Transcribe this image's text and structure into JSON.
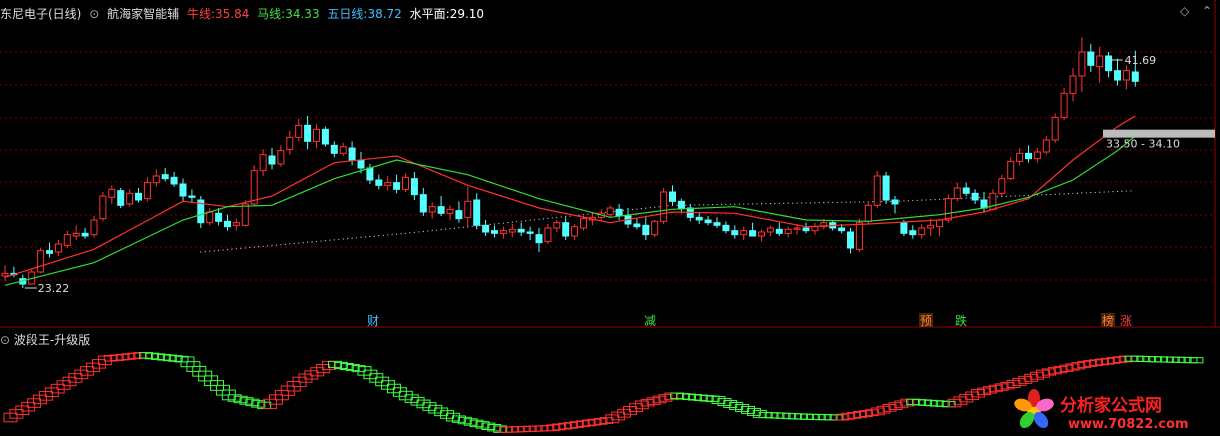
{
  "header": {
    "stock_title": "东尼电子(日线)",
    "indicator_name": "航海家智能辅",
    "ma_labels": [
      {
        "name": "牛线:",
        "value": "35.84",
        "color": "#ff4040"
      },
      {
        "name": "马线:",
        "value": "34.33",
        "color": "#40e040"
      },
      {
        "name": "五日线:",
        "value": "38.72",
        "color": "#40c0ff"
      },
      {
        "name": "水平面:",
        "value": "29.10",
        "color": "#ffffff"
      }
    ]
  },
  "sub_header": {
    "indicator_name": "波段王-升级版"
  },
  "signals": [
    {
      "text": "财",
      "color": "#40c0ff"
    },
    {
      "text": "减",
      "color": "#40e040"
    },
    {
      "text": "预",
      "color": "#ff8040"
    },
    {
      "text": "跌",
      "color": "#40e040"
    },
    {
      "text": "榜",
      "color": "#ff8040"
    },
    {
      "text": "涨",
      "color": "#ff4040"
    }
  ],
  "annotations": {
    "low_label": "23.22",
    "high_label": "41.69",
    "range_label": "33.50 - 34.10"
  },
  "watermark": {
    "name": "分析家公式网",
    "url": "www.70822.com"
  },
  "colors": {
    "up": "#ff3232",
    "down": "#54ffff",
    "ma_bull": "#ff3030",
    "ma_horse": "#30e030",
    "level_dots": "#cccccc",
    "grid": "#800000",
    "wave_up": "#ff3030",
    "wave_down": "#40ff40"
  },
  "chart_data": [
    {
      "type": "candlestick",
      "title": "东尼电子(日线)",
      "ylim": [
        22,
        43
      ],
      "candles": [
        [
          23.8,
          24.6,
          23.4,
          24.0
        ],
        [
          24.0,
          24.5,
          23.7,
          23.9
        ],
        [
          23.6,
          23.9,
          22.9,
          23.2
        ],
        [
          23.2,
          24.3,
          23.2,
          24.1
        ],
        [
          24.1,
          25.9,
          24.0,
          25.7
        ],
        [
          25.7,
          26.3,
          25.2,
          25.5
        ],
        [
          25.6,
          26.5,
          25.3,
          26.2
        ],
        [
          26.1,
          27.2,
          25.9,
          26.9
        ],
        [
          26.8,
          27.6,
          26.5,
          27.0
        ],
        [
          27.0,
          27.4,
          26.6,
          26.8
        ],
        [
          26.9,
          28.3,
          26.7,
          28.0
        ],
        [
          28.1,
          30.1,
          27.9,
          29.8
        ],
        [
          29.7,
          30.6,
          29.2,
          30.3
        ],
        [
          30.2,
          30.4,
          28.9,
          29.1
        ],
        [
          29.2,
          30.3,
          29.0,
          30.0
        ],
        [
          30.0,
          30.4,
          29.3,
          29.5
        ],
        [
          29.6,
          31.2,
          29.4,
          30.8
        ],
        [
          30.8,
          31.8,
          30.5,
          31.3
        ],
        [
          31.4,
          31.9,
          30.9,
          31.1
        ],
        [
          31.2,
          31.6,
          30.5,
          30.7
        ],
        [
          30.7,
          31.1,
          29.4,
          29.8
        ],
        [
          29.8,
          30.3,
          29.3,
          29.7
        ],
        [
          29.5,
          29.8,
          27.4,
          27.8
        ],
        [
          27.8,
          28.9,
          27.6,
          28.6
        ],
        [
          28.5,
          28.9,
          27.6,
          27.9
        ],
        [
          27.9,
          28.4,
          27.2,
          27.5
        ],
        [
          27.6,
          28.1,
          27.2,
          27.8
        ],
        [
          27.6,
          29.5,
          27.5,
          29.2
        ],
        [
          29.2,
          32.1,
          29.1,
          31.7
        ],
        [
          31.7,
          33.3,
          31.3,
          32.9
        ],
        [
          32.8,
          33.4,
          31.8,
          32.2
        ],
        [
          32.2,
          33.6,
          32.0,
          33.2
        ],
        [
          33.3,
          34.7,
          32.9,
          34.2
        ],
        [
          34.2,
          35.6,
          33.9,
          35.1
        ],
        [
          35.1,
          35.8,
          33.3,
          33.9
        ],
        [
          33.9,
          35.2,
          33.4,
          34.8
        ],
        [
          34.8,
          35.0,
          33.5,
          33.7
        ],
        [
          33.6,
          33.9,
          32.7,
          33.0
        ],
        [
          33.0,
          33.8,
          32.8,
          33.5
        ],
        [
          33.4,
          33.9,
          32.1,
          32.5
        ],
        [
          32.5,
          33.1,
          31.5,
          31.9
        ],
        [
          31.9,
          32.2,
          30.7,
          31.0
        ],
        [
          31.0,
          31.4,
          30.3,
          30.6
        ],
        [
          30.6,
          31.3,
          30.2,
          30.8
        ],
        [
          30.8,
          31.4,
          30.0,
          30.3
        ],
        [
          30.3,
          31.5,
          30.1,
          31.2
        ],
        [
          31.1,
          31.6,
          29.5,
          29.9
        ],
        [
          29.9,
          30.4,
          28.3,
          28.6
        ],
        [
          28.6,
          29.3,
          28.1,
          29.0
        ],
        [
          29.0,
          29.8,
          28.3,
          28.5
        ],
        [
          28.5,
          29.1,
          28.0,
          28.8
        ],
        [
          28.7,
          29.4,
          27.8,
          28.1
        ],
        [
          28.2,
          30.5,
          27.4,
          29.4
        ],
        [
          29.5,
          30.0,
          27.3,
          27.6
        ],
        [
          27.6,
          28.0,
          26.8,
          27.1
        ],
        [
          27.2,
          27.6,
          26.7,
          27.0
        ],
        [
          27.0,
          27.5,
          26.6,
          27.2
        ],
        [
          27.1,
          27.7,
          26.7,
          27.3
        ],
        [
          27.3,
          27.8,
          26.8,
          27.1
        ],
        [
          27.1,
          27.5,
          26.5,
          27.0
        ],
        [
          26.9,
          27.4,
          25.6,
          26.3
        ],
        [
          26.4,
          27.7,
          26.2,
          27.4
        ],
        [
          27.4,
          28.0,
          27.1,
          27.8
        ],
        [
          27.8,
          28.2,
          26.5,
          26.8
        ],
        [
          26.8,
          27.7,
          26.5,
          27.5
        ],
        [
          27.4,
          28.3,
          27.2,
          28.1
        ],
        [
          28.0,
          28.4,
          27.6,
          28.2
        ],
        [
          28.2,
          28.8,
          27.9,
          28.5
        ],
        [
          28.4,
          29.1,
          28.2,
          28.9
        ],
        [
          28.8,
          29.2,
          28.0,
          28.3
        ],
        [
          28.3,
          28.9,
          27.4,
          27.7
        ],
        [
          27.7,
          28.1,
          27.3,
          27.5
        ],
        [
          27.6,
          28.2,
          26.5,
          26.9
        ],
        [
          26.9,
          28.0,
          26.7,
          27.9
        ],
        [
          27.9,
          30.4,
          27.7,
          30.1
        ],
        [
          30.1,
          30.6,
          29.1,
          29.4
        ],
        [
          29.4,
          29.6,
          28.5,
          28.9
        ],
        [
          28.9,
          29.2,
          27.9,
          28.2
        ],
        [
          28.2,
          28.6,
          27.7,
          28.0
        ],
        [
          28.0,
          28.3,
          27.6,
          27.8
        ],
        [
          27.8,
          28.2,
          27.4,
          27.6
        ],
        [
          27.6,
          27.9,
          27.0,
          27.2
        ],
        [
          27.2,
          27.6,
          26.6,
          26.9
        ],
        [
          26.9,
          27.5,
          26.5,
          27.2
        ],
        [
          27.2,
          27.8,
          26.8,
          26.8
        ],
        [
          26.8,
          27.3,
          26.4,
          27.1
        ],
        [
          27.1,
          27.6,
          26.8,
          27.4
        ],
        [
          27.3,
          27.8,
          26.8,
          27.0
        ],
        [
          27.0,
          27.5,
          26.7,
          27.3
        ],
        [
          27.3,
          27.7,
          26.9,
          27.4
        ],
        [
          27.4,
          27.8,
          27.0,
          27.2
        ],
        [
          27.2,
          27.8,
          26.9,
          27.5
        ],
        [
          27.5,
          28.1,
          27.3,
          27.8
        ],
        [
          27.8,
          28.0,
          27.2,
          27.4
        ],
        [
          27.4,
          27.7,
          27.0,
          27.2
        ],
        [
          27.1,
          27.4,
          25.5,
          25.9
        ],
        [
          25.8,
          28.1,
          25.6,
          27.8
        ],
        [
          27.9,
          29.4,
          27.7,
          29.1
        ],
        [
          29.1,
          31.7,
          28.9,
          31.3
        ],
        [
          31.3,
          31.6,
          29.2,
          29.5
        ],
        [
          29.5,
          29.8,
          28.5,
          29.2
        ],
        [
          27.8,
          28.0,
          26.8,
          27.0
        ],
        [
          27.2,
          27.6,
          26.6,
          26.9
        ],
        [
          26.9,
          27.7,
          26.6,
          27.4
        ],
        [
          27.4,
          28.1,
          26.8,
          27.6
        ],
        [
          27.5,
          28.1,
          26.8,
          28.0
        ],
        [
          28.0,
          29.9,
          27.8,
          29.6
        ],
        [
          29.6,
          30.8,
          29.4,
          30.4
        ],
        [
          30.4,
          30.8,
          29.8,
          30.0
        ],
        [
          30.0,
          30.3,
          29.2,
          29.5
        ],
        [
          29.5,
          30.1,
          28.6,
          28.9
        ],
        [
          28.8,
          30.3,
          28.7,
          30.0
        ],
        [
          30.0,
          31.4,
          29.8,
          31.1
        ],
        [
          31.1,
          32.7,
          31.0,
          32.4
        ],
        [
          32.4,
          33.4,
          32.1,
          33.0
        ],
        [
          33.0,
          33.6,
          32.3,
          32.6
        ],
        [
          32.6,
          33.4,
          32.3,
          33.1
        ],
        [
          33.1,
          34.3,
          32.9,
          34.0
        ],
        [
          34.0,
          36.0,
          33.8,
          35.7
        ],
        [
          35.7,
          37.9,
          35.5,
          37.5
        ],
        [
          37.5,
          39.4,
          36.9,
          38.8
        ],
        [
          38.8,
          41.7,
          37.6,
          40.6
        ],
        [
          40.6,
          41.2,
          39.1,
          39.6
        ],
        [
          39.5,
          41.0,
          38.3,
          40.3
        ],
        [
          40.3,
          40.6,
          38.7,
          39.2
        ],
        [
          39.2,
          40.1,
          38.1,
          38.5
        ],
        [
          38.5,
          39.6,
          37.8,
          39.2
        ],
        [
          39.1,
          40.7,
          38.0,
          38.4
        ]
      ],
      "ma_bull": [
        [
          0,
          23.7
        ],
        [
          10,
          25.8
        ],
        [
          20,
          29.4
        ],
        [
          25,
          29.0
        ],
        [
          30,
          29.8
        ],
        [
          37,
          32.3
        ],
        [
          44,
          32.8
        ],
        [
          52,
          30.6
        ],
        [
          60,
          28.9
        ],
        [
          68,
          27.8
        ],
        [
          75,
          28.6
        ],
        [
          82,
          28.5
        ],
        [
          90,
          27.5
        ],
        [
          97,
          27.7
        ],
        [
          105,
          28.0
        ],
        [
          110,
          28.6
        ],
        [
          115,
          29.6
        ],
        [
          120,
          32.5
        ],
        [
          125,
          35.0
        ],
        [
          127,
          35.8
        ]
      ],
      "ma_horse": [
        [
          0,
          23.1
        ],
        [
          10,
          24.8
        ],
        [
          20,
          28.0
        ],
        [
          25,
          29.0
        ],
        [
          30,
          29.1
        ],
        [
          37,
          31.1
        ],
        [
          44,
          32.5
        ],
        [
          52,
          31.4
        ],
        [
          60,
          29.6
        ],
        [
          68,
          28.2
        ],
        [
          75,
          28.8
        ],
        [
          82,
          29.0
        ],
        [
          90,
          28.0
        ],
        [
          97,
          27.9
        ],
        [
          105,
          28.4
        ],
        [
          110,
          28.9
        ],
        [
          115,
          29.7
        ],
        [
          120,
          31.0
        ],
        [
          125,
          33.2
        ],
        [
          127,
          34.3
        ]
      ],
      "level_dots": [
        [
          22,
          25.6
        ],
        [
          45,
          27.0
        ],
        [
          75,
          29.1
        ],
        [
          100,
          29.4
        ],
        [
          127,
          30.2
        ]
      ]
    },
    {
      "type": "line",
      "title": "波段王-升级版",
      "ylim": [
        0,
        10
      ],
      "series": [
        {
          "values": [
            [
              0,
              1.5
            ],
            [
              10,
              5.6
            ],
            [
              17,
              8.4
            ],
            [
              23,
              8.8
            ],
            [
              30,
              8.3
            ],
            [
              38,
              4.0
            ],
            [
              44,
              3.0
            ],
            [
              50,
              6.0
            ],
            [
              55,
              7.8
            ],
            [
              60,
              7.2
            ],
            [
              68,
              4.0
            ],
            [
              76,
              1.6
            ],
            [
              84,
              0.3
            ],
            [
              92,
              0.5
            ],
            [
              102,
              1.4
            ],
            [
              108,
              3.3
            ],
            [
              113,
              4.2
            ],
            [
              120,
              3.8
            ],
            [
              128,
              2.0
            ],
            [
              135,
              1.8
            ],
            [
              141,
              1.7
            ],
            [
              147,
              2.3
            ],
            [
              153,
              3.5
            ],
            [
              160,
              3.2
            ],
            [
              165,
              4.6
            ],
            [
              170,
              5.4
            ],
            [
              176,
              6.8
            ],
            [
              183,
              7.8
            ],
            [
              190,
              8.4
            ],
            [
              196,
              8.3
            ],
            [
              202,
              8.2
            ]
          ]
        }
      ]
    }
  ]
}
